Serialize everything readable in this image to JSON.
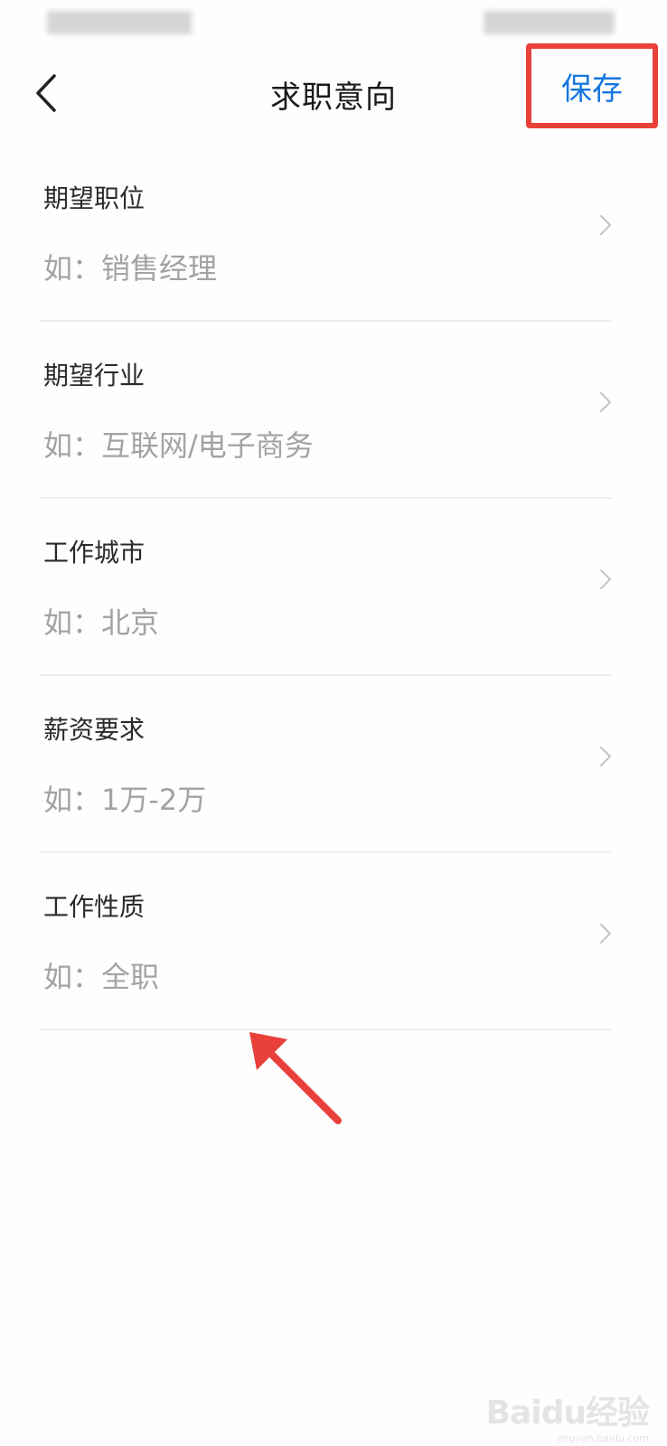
{
  "nav": {
    "title": "求职意向",
    "save_label": "保存"
  },
  "fields": [
    {
      "label": "期望职位",
      "placeholder": "如：销售经理"
    },
    {
      "label": "期望行业",
      "placeholder": "如：互联网/电子商务"
    },
    {
      "label": "工作城市",
      "placeholder": "如：北京"
    },
    {
      "label": "薪资要求",
      "placeholder": "如：1万-2万"
    },
    {
      "label": "工作性质",
      "placeholder": "如：全职"
    }
  ],
  "watermark": {
    "logo": "Baidu经验",
    "url": "jingyan.baidu.com"
  },
  "colors": {
    "accent": "#1777e0",
    "highlight": "#e8413a",
    "placeholder": "#a3a3a3"
  }
}
